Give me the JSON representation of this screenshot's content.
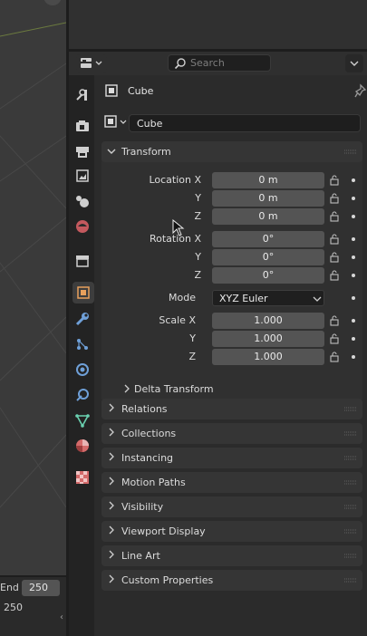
{
  "header": {
    "search_placeholder": "Search"
  },
  "object": {
    "name": "Cube",
    "data_name": "Cube"
  },
  "transform": {
    "title": "Transform",
    "location": {
      "label": "Location X",
      "labels": [
        "Y",
        "Z"
      ],
      "values": [
        "0 m",
        "0 m",
        "0 m"
      ]
    },
    "rotation": {
      "label": "Rotation X",
      "labels": [
        "Y",
        "Z"
      ],
      "values": [
        "0°",
        "0°",
        "0°"
      ]
    },
    "mode": {
      "label": "Mode",
      "value": "XYZ Euler"
    },
    "scale": {
      "label": "Scale X",
      "labels": [
        "Y",
        "Z"
      ],
      "values": [
        "1.000",
        "1.000",
        "1.000"
      ]
    },
    "delta": "Delta Transform"
  },
  "sections": [
    "Relations",
    "Collections",
    "Instancing",
    "Motion Paths",
    "Visibility",
    "Viewport Display",
    "Line Art",
    "Custom Properties"
  ],
  "timeline": {
    "end_label": "End",
    "end_value": "250",
    "frame_value": "250"
  },
  "icons": [
    "tool-icon",
    "render-icon",
    "output-icon",
    "view-layer-icon",
    "scene-icon",
    "world-icon",
    "collection-icon",
    "object-icon",
    "modifier-icon",
    "particles-icon",
    "physics-icon",
    "constraints-icon",
    "data-icon",
    "material-icon",
    "texture-icon"
  ],
  "colors": {
    "accent": "#e8a05c",
    "physics": "#6fa0d8",
    "material": "#d46a6a",
    "data": "#6ad1b0"
  }
}
